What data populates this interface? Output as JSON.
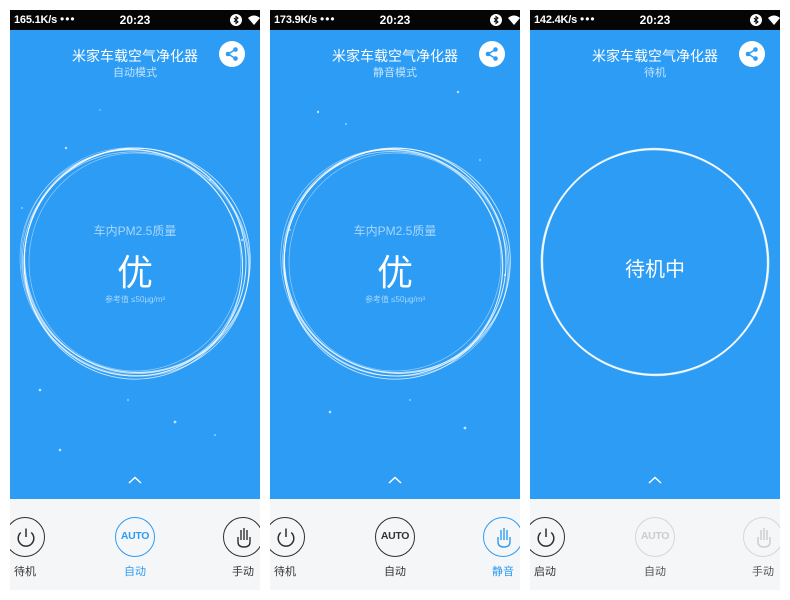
{
  "screens": [
    {
      "status": {
        "speed": "165.1K/s",
        "dots": "•••",
        "time": "20:23"
      },
      "title": "米家车载空气净化器",
      "subtitle": "自动模式",
      "pm_label": "车内PM2.5质量",
      "quality": "优",
      "reference": "参考值 ≤50μg/m³",
      "controls": [
        {
          "label": "待机",
          "icon": "power-icon"
        },
        {
          "label": "自动",
          "icon": "auto-icon",
          "icon_text": "AUTO",
          "selected": true
        },
        {
          "label": "手动",
          "icon": "hand-icon"
        }
      ]
    },
    {
      "status": {
        "speed": "173.9K/s",
        "dots": "•••",
        "time": "20:23"
      },
      "title": "米家车载空气净化器",
      "subtitle": "静音模式",
      "pm_label": "车内PM2.5质量",
      "quality": "优",
      "reference": "参考值 ≤50μg/m³",
      "controls": [
        {
          "label": "待机",
          "icon": "power-icon"
        },
        {
          "label": "自动",
          "icon": "auto-icon",
          "icon_text": "AUTO"
        },
        {
          "label": "静音",
          "icon": "hand-icon",
          "selected": true
        }
      ]
    },
    {
      "status": {
        "speed": "142.4K/s",
        "dots": "•••",
        "time": "20:23"
      },
      "title": "米家车载空气净化器",
      "subtitle": "待机",
      "standby_text": "待机中",
      "controls": [
        {
          "label": "启动",
          "icon": "power-icon"
        },
        {
          "label": "自动",
          "icon": "auto-icon",
          "icon_text": "AUTO",
          "disabled": true
        },
        {
          "label": "手动",
          "icon": "hand-icon",
          "disabled": true
        }
      ]
    }
  ],
  "colors": {
    "background": "#2c9cf5",
    "bottom_bar": "#f5f6f7",
    "accent": "#2c9cf5",
    "statusbar": "#050505"
  }
}
